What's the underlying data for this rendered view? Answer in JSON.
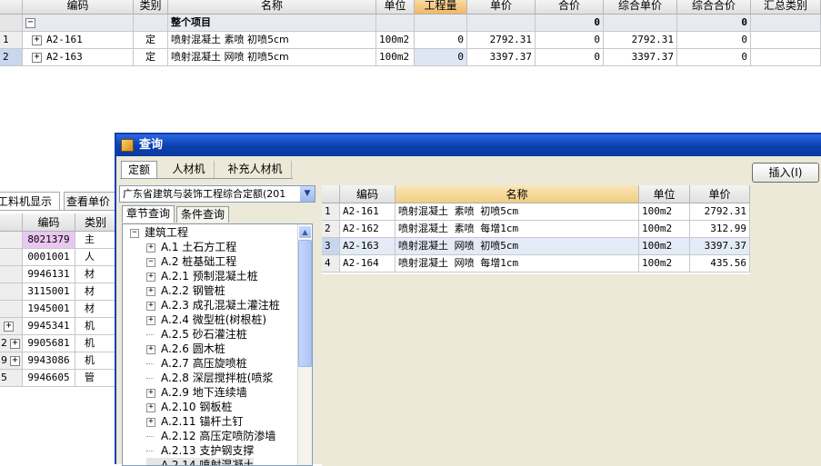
{
  "main_grid": {
    "headers": [
      "编码",
      "类别",
      "名称",
      "单位",
      "工程量",
      "单价",
      "合价",
      "综合单价",
      "综合合价",
      "汇总类别"
    ],
    "summary_row": {
      "expander": "−",
      "name": "整个项目",
      "total": "0",
      "comp_total": "0"
    },
    "rows": [
      {
        "index": "1",
        "expander": "+",
        "code": "A2-161",
        "type": "定",
        "name": "喷射混凝土 素喷 初喷5cm",
        "unit": "100m2",
        "qty": "0",
        "price": "2792.31",
        "total": "0",
        "comp_price": "2792.31",
        "comp_total": "0"
      },
      {
        "index": "2",
        "expander": "+",
        "code": "A2-163",
        "type": "定",
        "name": "喷射混凝土 网喷 初喷5cm",
        "unit": "100m2",
        "qty": "0",
        "price": "3397.37",
        "total": "0",
        "comp_price": "3397.37",
        "comp_total": "0"
      }
    ]
  },
  "left_panel": {
    "tabs": [
      "工料机显示",
      "查看单价"
    ],
    "headers": [
      "编码",
      "类别"
    ],
    "rows": [
      {
        "index": "",
        "expander": "",
        "code": "8021379",
        "type": "主",
        "highlight": true
      },
      {
        "index": "",
        "expander": "",
        "code": "0001001",
        "type": "人"
      },
      {
        "index": "",
        "expander": "",
        "code": "9946131",
        "type": "材"
      },
      {
        "index": "",
        "expander": "",
        "code": "3115001",
        "type": "材"
      },
      {
        "index": "",
        "expander": "",
        "code": "1945001",
        "type": "材"
      },
      {
        "index": "",
        "expander": "+",
        "code": "9945341",
        "type": "机"
      },
      {
        "index": "2",
        "expander": "+",
        "code": "9905681",
        "type": "机"
      },
      {
        "index": "9",
        "expander": "+",
        "code": "9943086",
        "type": "机"
      },
      {
        "index": "5",
        "expander": "",
        "code": "9946605",
        "type": "管"
      }
    ]
  },
  "dialog": {
    "title": "查询",
    "tabs": [
      "定额",
      "人材机",
      "补充人材机"
    ],
    "insert_button": "插入(I)",
    "quota_select": "广东省建筑与装饰工程综合定额(201",
    "sub_tabs": [
      "章节查询",
      "条件查询"
    ],
    "tree": [
      {
        "level": 0,
        "expander": "−",
        "label": "建筑工程"
      },
      {
        "level": 1,
        "expander": "+",
        "label": "A.1 土石方工程"
      },
      {
        "level": 1,
        "expander": "−",
        "label": "A.2 桩基础工程"
      },
      {
        "level": 2,
        "expander": "+",
        "label": "A.2.1 预制混凝土桩"
      },
      {
        "level": 2,
        "expander": "+",
        "label": "A.2.2 钢管桩"
      },
      {
        "level": 2,
        "expander": "+",
        "label": "A.2.3 成孔混凝土灌注桩"
      },
      {
        "level": 2,
        "expander": "+",
        "label": "A.2.4 微型桩(树根桩)"
      },
      {
        "level": 2,
        "expander": "",
        "label": "A.2.5 砂石灌注桩"
      },
      {
        "level": 2,
        "expander": "+",
        "label": "A.2.6 圆木桩"
      },
      {
        "level": 2,
        "expander": "",
        "label": "A.2.7 高压旋喷桩"
      },
      {
        "level": 2,
        "expander": "",
        "label": "A.2.8 深层搅拌桩(喷浆"
      },
      {
        "level": 2,
        "expander": "+",
        "label": "A.2.9 地下连续墙"
      },
      {
        "level": 2,
        "expander": "+",
        "label": "A.2.10 钢板桩"
      },
      {
        "level": 2,
        "expander": "+",
        "label": "A.2.11 锚杆土钉"
      },
      {
        "level": 2,
        "expander": "",
        "label": "A.2.12 高压定喷防渗墙"
      },
      {
        "level": 2,
        "expander": "",
        "label": "A.2.13 支护钢支撑"
      },
      {
        "level": 2,
        "expander": "",
        "label": "A.2.14 喷射混凝土"
      }
    ],
    "result_table": {
      "headers": [
        "编码",
        "名称",
        "单位",
        "单价"
      ],
      "rows": [
        {
          "index": "1",
          "code": "A2-161",
          "name": "喷射混凝土 素喷 初喷5cm",
          "unit": "100m2",
          "price": "2792.31"
        },
        {
          "index": "2",
          "code": "A2-162",
          "name": "喷射混凝土 素喷 每增1cm",
          "unit": "100m2",
          "price": "312.99"
        },
        {
          "index": "3",
          "code": "A2-163",
          "name": "喷射混凝土 网喷 初喷5cm",
          "unit": "100m2",
          "price": "3397.37",
          "selected": true
        },
        {
          "index": "4",
          "code": "A2-164",
          "name": "喷射混凝土 网喷 每增1cm",
          "unit": "100m2",
          "price": "435.56"
        }
      ]
    }
  },
  "colors": {
    "title_bar": "#0a3fb0",
    "selected_row": "#e3ebf6",
    "highlight_header": "#f5c98a",
    "name_header": "#f5e3b5",
    "pink_cell": "#e8c8f0"
  }
}
